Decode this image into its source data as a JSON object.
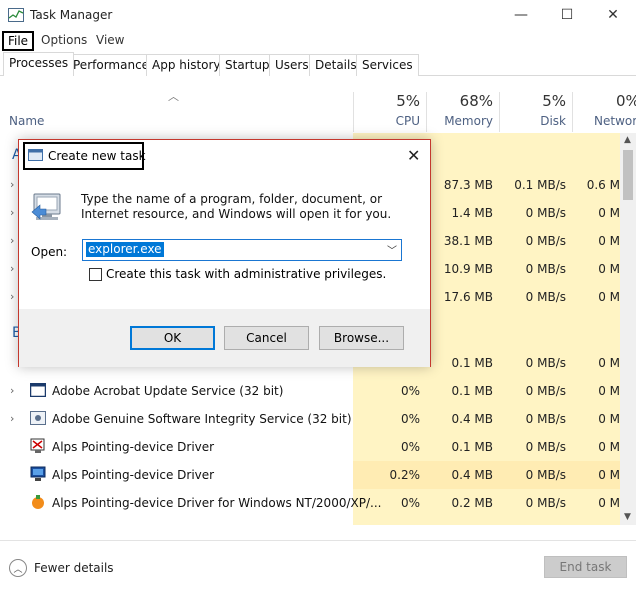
{
  "window": {
    "title": "Task Manager",
    "minimize_glyph": "—",
    "maximize_glyph": "☐",
    "close_glyph": "✕"
  },
  "menu": {
    "file": "File",
    "options": "Options",
    "view": "View"
  },
  "tabs": [
    {
      "label": "Processes"
    },
    {
      "label": "Performance"
    },
    {
      "label": "App history"
    },
    {
      "label": "Startup"
    },
    {
      "label": "Users"
    },
    {
      "label": "Details"
    },
    {
      "label": "Services"
    }
  ],
  "columns": {
    "name": "Name",
    "cpu_pct": "5%",
    "cpu": "CPU",
    "mem_pct": "68%",
    "mem": "Memory",
    "disk_pct": "5%",
    "disk": "Disk",
    "net_pct": "0%",
    "net": "Network"
  },
  "partial_rows": [
    {
      "mem": "87.3 MB",
      "disk": "0.1 MB/s",
      "net": "0.6 M"
    },
    {
      "mem": "1.4 MB",
      "disk": "0 MB/s",
      "net": "0 M"
    },
    {
      "mem": "38.1 MB",
      "disk": "0 MB/s",
      "net": "0 M"
    },
    {
      "mem": "10.9 MB",
      "disk": "0 MB/s",
      "net": "0 M"
    },
    {
      "mem": "17.6 MB",
      "disk": "0 MB/s",
      "net": "0 M"
    }
  ],
  "group_fragments": {
    "apps": "A",
    "background": "B"
  },
  "rows": [
    {
      "name": "",
      "cpu": "",
      "mem": "0.1 MB",
      "disk": "0 MB/s",
      "net": "0 M"
    },
    {
      "name": "Adobe Acrobat Update Service (32 bit)",
      "cpu": "0%",
      "mem": "0.1 MB",
      "disk": "0 MB/s",
      "net": "0 M"
    },
    {
      "name": "Adobe Genuine Software Integrity Service (32 bit)",
      "cpu": "0%",
      "mem": "0.4 MB",
      "disk": "0 MB/s",
      "net": "0 M"
    },
    {
      "name": "Alps Pointing-device Driver",
      "cpu": "0%",
      "mem": "0.1 MB",
      "disk": "0 MB/s",
      "net": "0 M"
    },
    {
      "name": "Alps Pointing-device Driver",
      "cpu": "0.2%",
      "mem": "0.4 MB",
      "disk": "0 MB/s",
      "net": "0 M"
    },
    {
      "name": "Alps Pointing-device Driver for Windows NT/2000/XP/...",
      "cpu": "0%",
      "mem": "0.2 MB",
      "disk": "0 MB/s",
      "net": "0 M"
    }
  ],
  "footer": {
    "fewer_details": "Fewer details",
    "end_task": "End task"
  },
  "dialog": {
    "title": "Create new task",
    "close_glyph": "✕",
    "message": "Type the name of a program, folder, document, or Internet resource, and Windows will open it for you.",
    "open_label": "Open:",
    "open_value": "explorer.exe",
    "admin_label": "Create this task with administrative privileges.",
    "ok": "OK",
    "cancel": "Cancel",
    "browse": "Browse..."
  },
  "colors": {
    "selection": "#0078d7",
    "heat_cell": "#fff4c4",
    "dialog_border": "#c4382e"
  }
}
